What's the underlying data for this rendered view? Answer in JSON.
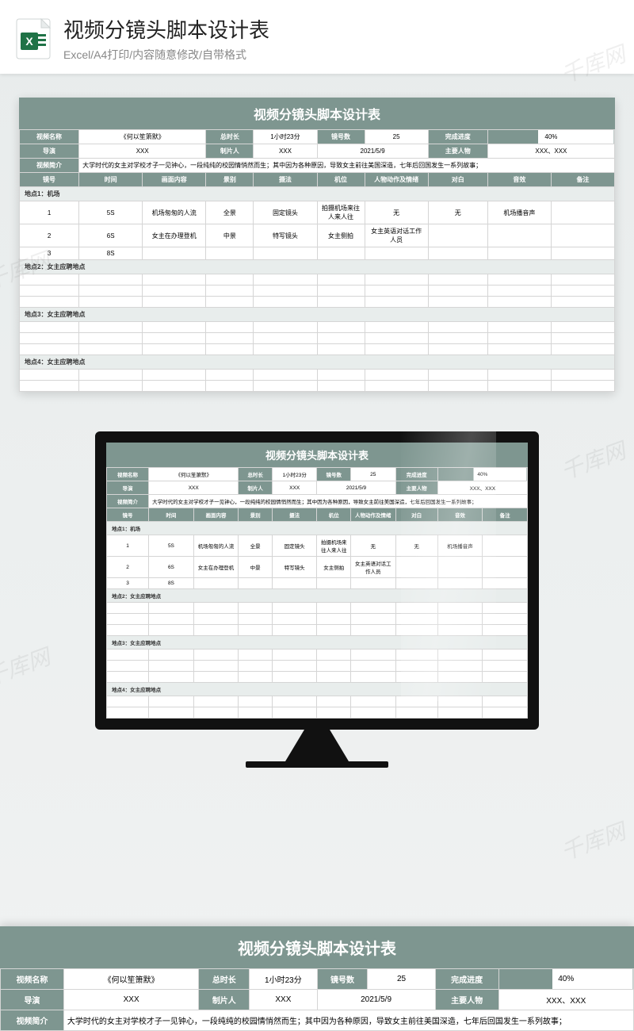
{
  "header": {
    "title": "视频分镜头脚本设计表",
    "subtitle": "Excel/A4打印/内容随意修改/自带格式"
  },
  "watermark": "千库网",
  "sheet": {
    "title": "视频分镜头脚本设计表",
    "meta": {
      "video_name_label": "视频名称",
      "video_name": "《何以笙箫默》",
      "duration_label": "总时长",
      "duration": "1小时23分",
      "shot_count_label": "镜号数",
      "shot_count": "25",
      "progress_label": "完成进度",
      "progress": "40%",
      "director_label": "导演",
      "director": "XXX",
      "producer_label": "制片人",
      "producer": "XXX",
      "date": "2021/5/9",
      "main_char_label": "主要人物",
      "main_char": "XXX、XXX",
      "synopsis_label": "视频简介",
      "synopsis": "大学时代的女主对学校才子一见钟心，一段纯纯的校园情悄然而生；其中因为各种原因，导致女主前往美国深造，七年后回国发生一系列故事；"
    },
    "columns": [
      "镜号",
      "时间",
      "画面内容",
      "景别",
      "摄法",
      "机位",
      "人物动作及情绪",
      "对白",
      "音效",
      "备注"
    ],
    "sections": [
      {
        "label": "地点1：机场",
        "rows": [
          [
            "1",
            "5S",
            "机场匆匆的人流",
            "全景",
            "固定镜头",
            "拍摄机场来往人来人往",
            "无",
            "无",
            "机场播音声",
            ""
          ],
          [
            "2",
            "6S",
            "女主在办理登机",
            "中景",
            "特写镜头",
            "女主侧拍",
            "女主英语对话工作人员",
            "",
            "",
            ""
          ],
          [
            "3",
            "8S",
            "",
            "",
            "",
            "",
            "",
            "",
            "",
            ""
          ]
        ]
      },
      {
        "label": "地点2：女主应聘地点",
        "rows": [
          [
            "",
            "",
            "",
            "",
            "",
            "",
            "",
            "",
            "",
            ""
          ],
          [
            "",
            "",
            "",
            "",
            "",
            "",
            "",
            "",
            "",
            ""
          ],
          [
            "",
            "",
            "",
            "",
            "",
            "",
            "",
            "",
            "",
            ""
          ]
        ]
      },
      {
        "label": "地点3：女主应聘地点",
        "rows": [
          [
            "",
            "",
            "",
            "",
            "",
            "",
            "",
            "",
            "",
            ""
          ],
          [
            "",
            "",
            "",
            "",
            "",
            "",
            "",
            "",
            "",
            ""
          ],
          [
            "",
            "",
            "",
            "",
            "",
            "",
            "",
            "",
            "",
            ""
          ]
        ]
      },
      {
        "label": "地点4：女主应聘地点",
        "rows": [
          [
            "",
            "",
            "",
            "",
            "",
            "",
            "",
            "",
            "",
            ""
          ],
          [
            "",
            "",
            "",
            "",
            "",
            "",
            "",
            "",
            "",
            ""
          ]
        ]
      }
    ]
  },
  "bottom_synopsis_cut": "大学时代的女主对学校才子一见钟心，一段纯纯的校园情悄然而生；其中因为各种原因，导致女主前往美国深造，七年后回国发生一系列故事；"
}
